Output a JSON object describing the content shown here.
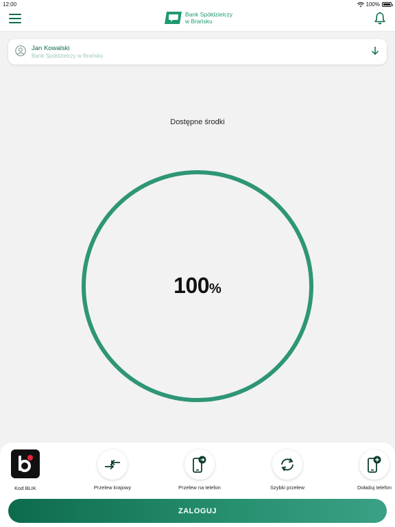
{
  "status_bar": {
    "time": "12:00",
    "battery": "100%"
  },
  "header": {
    "logo_line1": "Bank Spółdzielczy",
    "logo_line2": "w Brańsku",
    "menu_icon": "hamburger-icon",
    "notification_icon": "bell-icon"
  },
  "account": {
    "name": "Jan Kowalski",
    "bank": "Bank Spółdzielczy w Brańsku",
    "icon": "user-icon",
    "expand_icon": "arrow-down-icon"
  },
  "funds": {
    "label": "Dostępne środki",
    "percent_value": "100",
    "percent_sign": "%",
    "fill_fraction": 1.0
  },
  "quick_actions": [
    {
      "label": "Kod BLIK",
      "icon": "blik-logo"
    },
    {
      "label": "Przelew krajowy",
      "icon": "transfer-arrows-icon"
    },
    {
      "label": "Przelew na telefon",
      "icon": "phone-transfer-icon"
    },
    {
      "label": "Szybki przelew",
      "icon": "sync-icon"
    },
    {
      "label": "Doładuj telefon",
      "icon": "phone-topup-icon"
    }
  ],
  "login_button": "ZALOGUJ",
  "colors": {
    "brand_green": "#0f6b4f",
    "ring": "#2e9676",
    "accent": "#1e9a6e"
  }
}
